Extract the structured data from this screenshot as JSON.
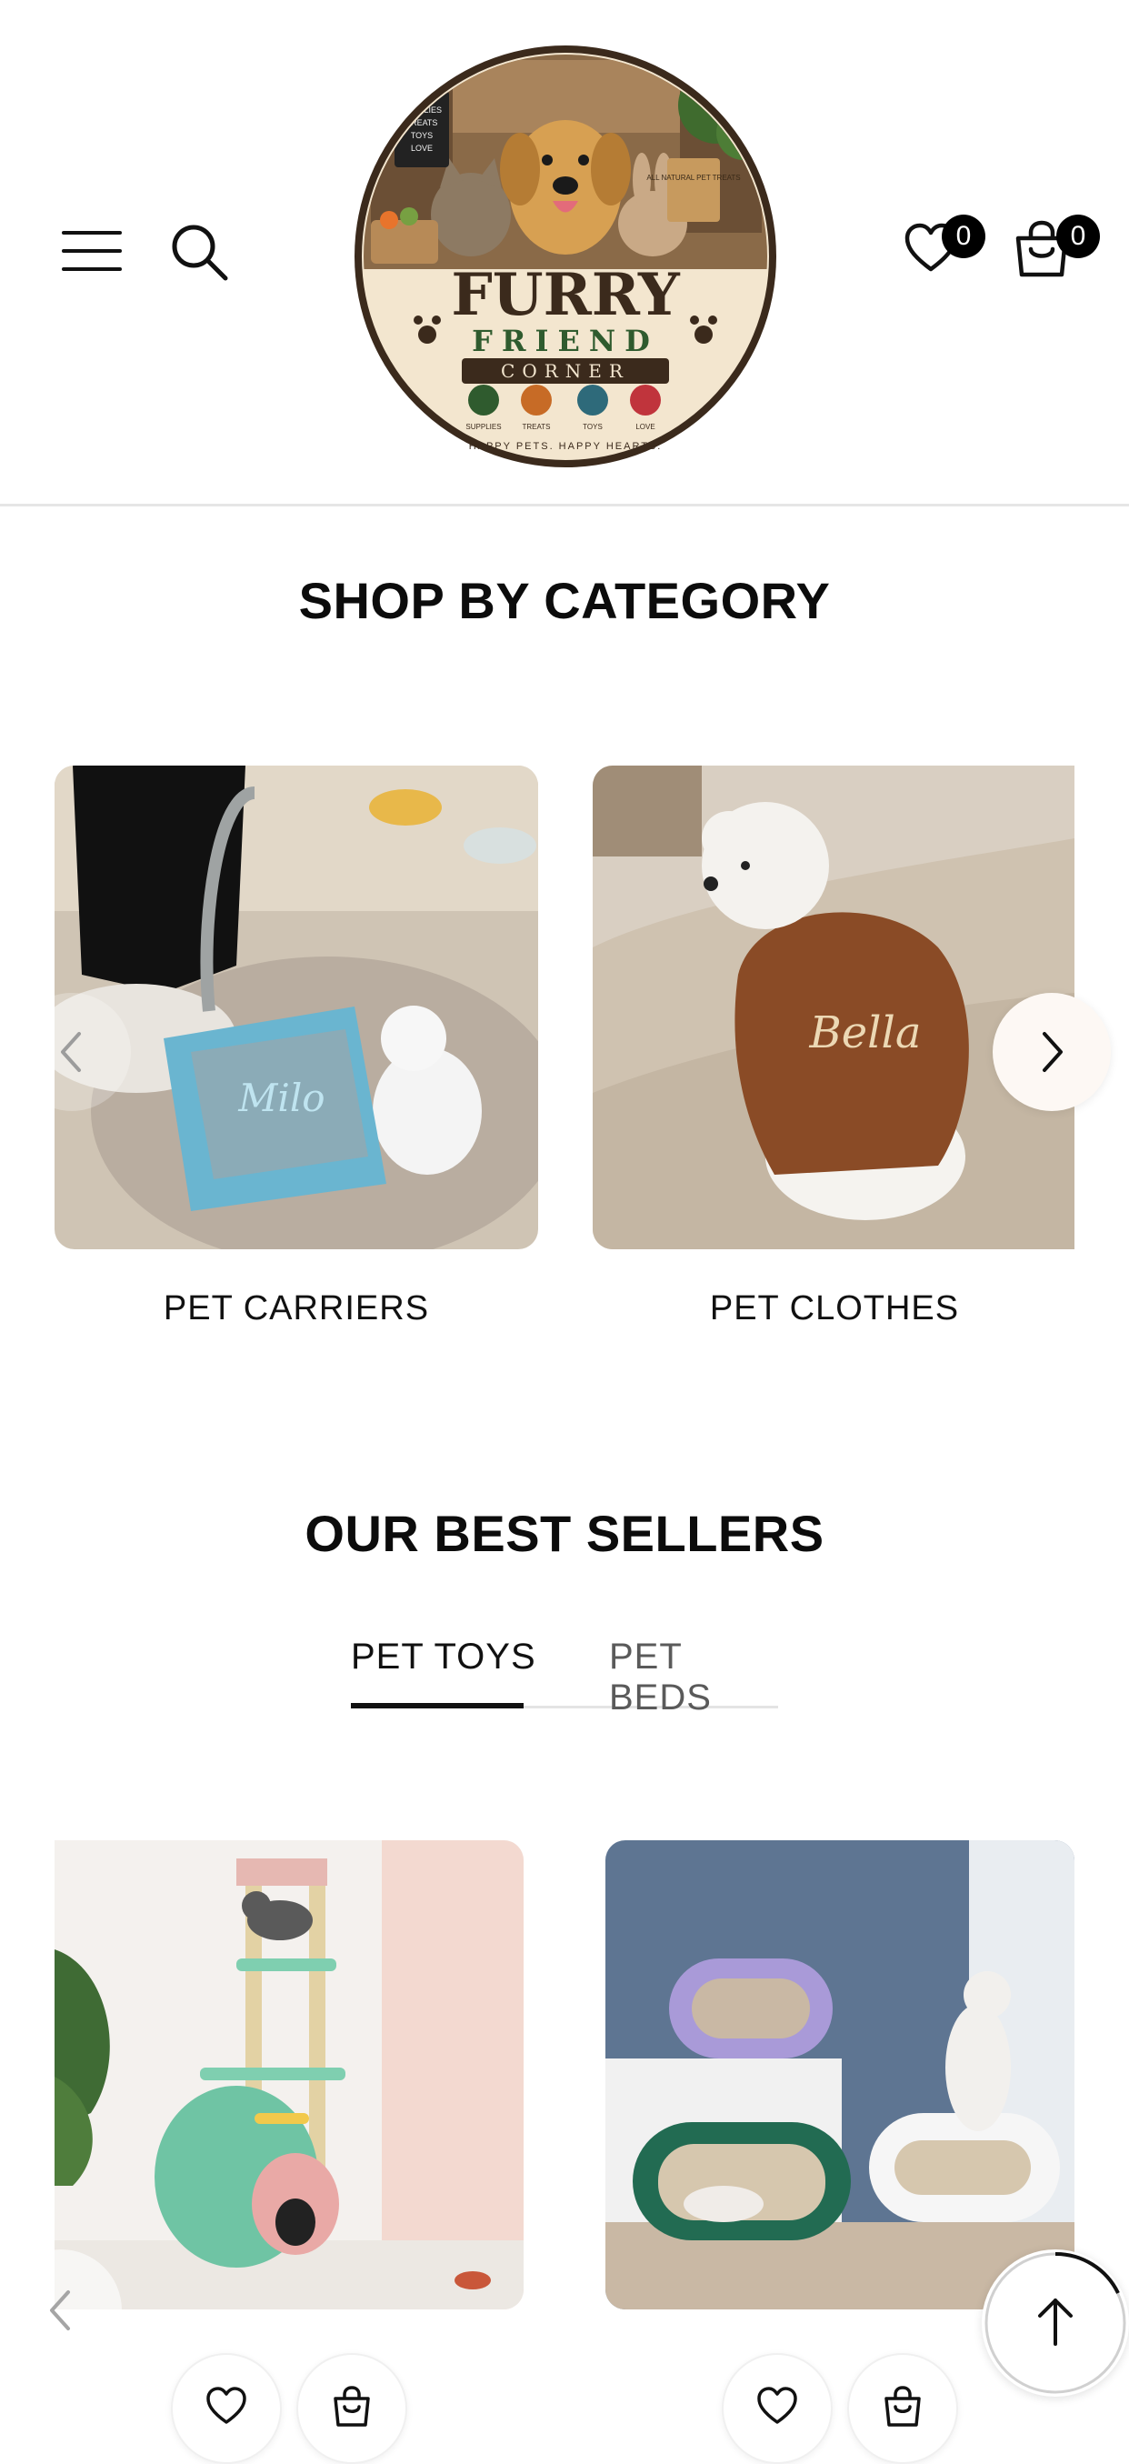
{
  "header": {
    "logo": {
      "brand_top": "FURRY",
      "brand_mid": "FRIEND",
      "brand_bottom": "CORNER",
      "sign_lines": [
        "SUPPLIES",
        "TREATS",
        "TOYS",
        "LOVE"
      ],
      "jar_text": "ALL NATURAL PET TREATS",
      "icon_labels": [
        "SUPPLIES",
        "TREATS",
        "TOYS",
        "LOVE"
      ],
      "tagline": "HAPPY PETS. HAPPY HEARTS."
    },
    "wishlist_count": "0",
    "cart_count": "0"
  },
  "categories": {
    "title": "SHOP BY CATEGORY",
    "items": [
      {
        "label": "PET CARRIERS",
        "bag_text": "Milo"
      },
      {
        "label": "PET CLOTHES",
        "hoodie_text": "Bella"
      }
    ]
  },
  "best_sellers": {
    "title": "OUR BEST SELLERS",
    "tabs": [
      {
        "label": "PET TOYS",
        "active": true
      },
      {
        "label": "PET BEDS",
        "active": false
      }
    ]
  },
  "colors": {
    "text": "#111111",
    "tab_inactive": "#5a5a5a",
    "badge_bg": "#000000",
    "divider": "#e6e6e6"
  },
  "icons": [
    "hamburger-menu-icon",
    "search-icon",
    "heart-icon",
    "shopping-bag-icon",
    "chevron-left-icon",
    "chevron-right-icon",
    "arrow-up-icon"
  ]
}
